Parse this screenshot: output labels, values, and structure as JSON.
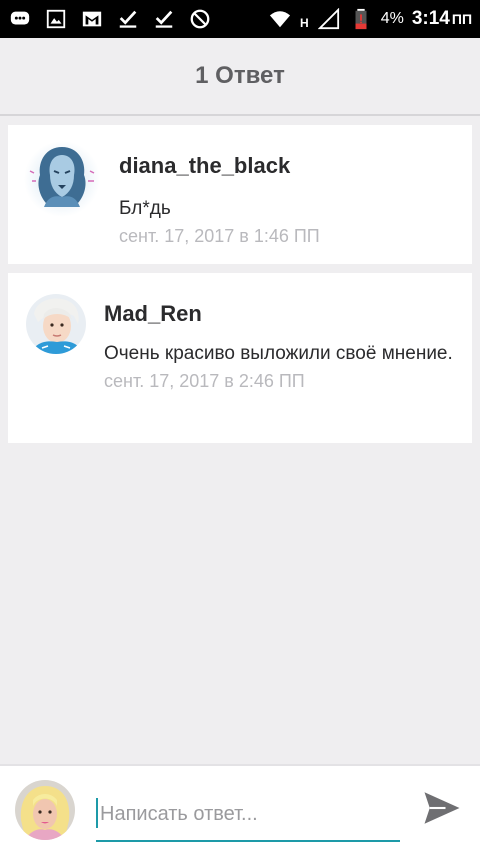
{
  "status_bar": {
    "battery_percent": "4%",
    "time": "3:14",
    "ampm": "ПП",
    "network": "H",
    "icons": [
      "message-icon",
      "image-icon",
      "gmail-icon",
      "check-icon",
      "check-icon",
      "do-not-disturb-icon",
      "wifi-icon",
      "signal-icon",
      "battery-icon"
    ]
  },
  "header": {
    "title": "1 Ответ"
  },
  "comments": [
    {
      "author": "diana_the_black",
      "text": "Бл*дь",
      "date": "сент. 17, 2017 в 1:46 ПП"
    },
    {
      "author": "Mad_Ren",
      "text": "Очень красиво выложили своё мнение.",
      "date": "сент. 17, 2017 в 2:46 ПП"
    }
  ],
  "reply": {
    "placeholder": "Написать ответ...",
    "value": ""
  },
  "colors": {
    "accent": "#1d9aa8",
    "background": "#efeef0",
    "card": "#ffffff",
    "muted_text": "#b9b9bd",
    "header_text": "#5f5f62"
  }
}
